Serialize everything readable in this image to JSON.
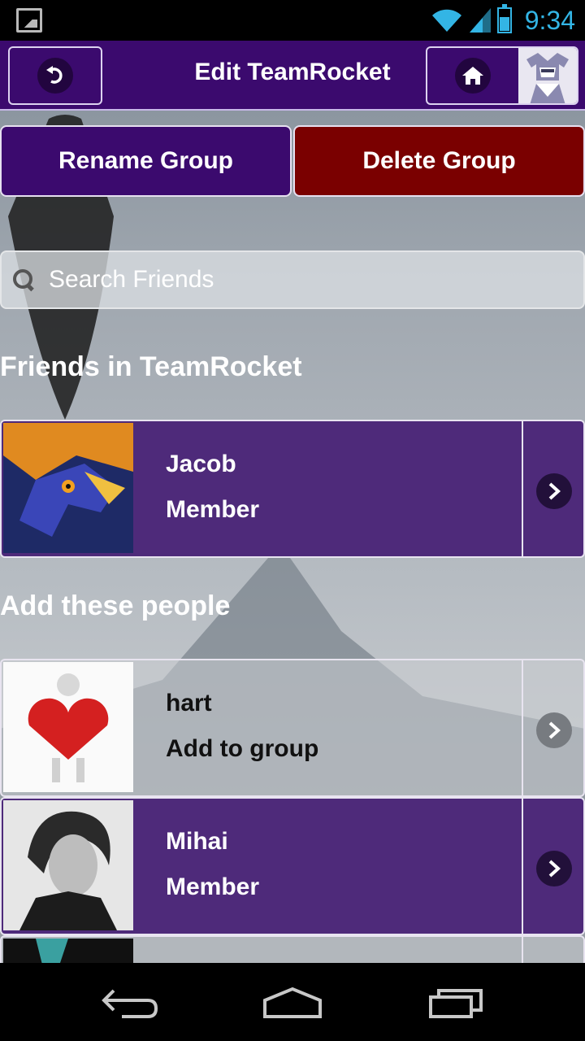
{
  "status_bar": {
    "time": "9:34"
  },
  "header": {
    "title": "Edit TeamRocket"
  },
  "actions": {
    "rename_label": "Rename Group",
    "delete_label": "Delete Group"
  },
  "search": {
    "placeholder": "Search Friends"
  },
  "sections": {
    "members_title": "Friends in TeamRocket",
    "suggestions_title": "Add these people"
  },
  "members": [
    {
      "name": "Jacob",
      "role": "Member"
    }
  ],
  "suggestions": [
    {
      "name": "hart",
      "action": "Add to group"
    },
    {
      "name": "Mihai",
      "action": "Member"
    }
  ],
  "colors": {
    "header": "#3b0a6e",
    "delete": "#7a0000",
    "row_purple": "#4e2a7a",
    "status_accent": "#33b5e5"
  },
  "icons": [
    "picture-icon",
    "wifi-icon",
    "signal-icon",
    "battery-icon",
    "undo-icon",
    "home-icon",
    "chevron-right-icon",
    "search-icon",
    "back-nav-icon",
    "home-nav-icon",
    "recents-nav-icon"
  ]
}
